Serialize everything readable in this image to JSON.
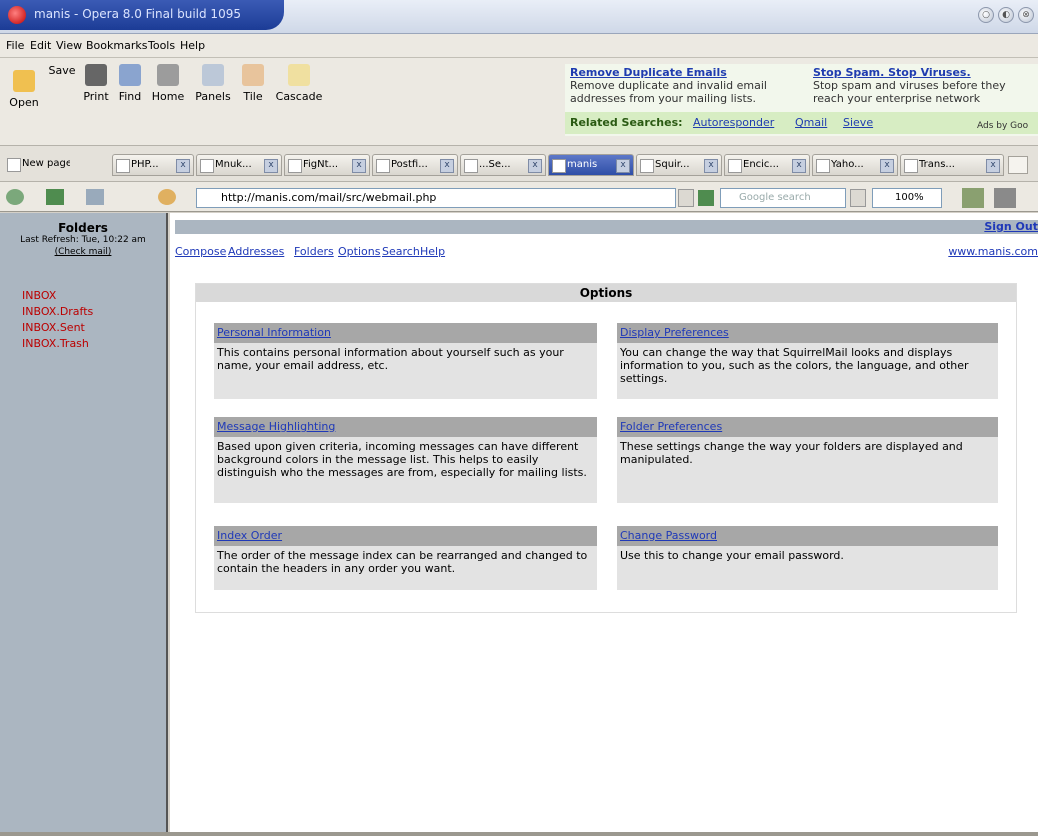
{
  "window": {
    "title": "manis - Opera 8.0 Final build 1095",
    "controls": [
      "○",
      "◐",
      "⊗"
    ]
  },
  "menu": [
    "File",
    "Edit",
    "View",
    "Bookmarks",
    "Tools",
    "Help"
  ],
  "toolbar": {
    "open": "Open",
    "save": "Save",
    "print": "Print",
    "find": "Find",
    "home": "Home",
    "panels": "Panels",
    "tile": "Tile",
    "cascade": "Cascade"
  },
  "ads": {
    "ad1_title": "Remove Duplicate Emails",
    "ad1_text": "Remove duplicate and invalid email addresses from your mailing lists.",
    "ad2_title": "Stop Spam. Stop Viruses.",
    "ad2_text": "Stop spam and viruses before they reach your enterprise network",
    "related_prefix": "Related Searches:",
    "related_1": "Autoresponder",
    "related_2": "Qmail",
    "related_3": "Sieve",
    "ads_by": "Ads by Goo"
  },
  "tabs": [
    "New page",
    "PHP...",
    "Mnuk...",
    "FigNt...",
    "Postfi...",
    "...Se...",
    "manis",
    "Squir...",
    "Encic...",
    "Yaho...",
    "Trans..."
  ],
  "address": {
    "url": "http://manis.com/mail/src/webmail.php",
    "search_placeholder": "Google search",
    "zoom": "100%"
  },
  "sidebar": {
    "title": "Folders",
    "last_refresh": "Last Refresh: Tue, 10:22 am",
    "check_mail": "(Check mail)",
    "folders": [
      "INBOX",
      "INBOX.Drafts",
      "INBOX.Sent",
      "INBOX.Trash"
    ]
  },
  "main": {
    "sign_out": "Sign Out",
    "nav": [
      "Compose",
      "Addresses",
      "Folders",
      "Options",
      "Search",
      "Help"
    ],
    "site": "www.manis.com",
    "options_title": "Options",
    "options": [
      {
        "title": "Personal Information",
        "desc": "This contains personal information about yourself such as your name, your email address, etc."
      },
      {
        "title": "Display Preferences",
        "desc": "You can change the way that SquirrelMail looks and displays information to you, such as the colors, the language, and other settings."
      },
      {
        "title": "Message Highlighting",
        "desc": "Based upon given criteria, incoming messages can have different background colors in the message list. This helps to easily distinguish who the messages are from, especially for mailing lists."
      },
      {
        "title": "Folder Preferences",
        "desc": "These settings change the way your folders are displayed and manipulated."
      },
      {
        "title": "Index Order",
        "desc": "The order of the message index can be rearranged and changed to contain the headers in any order you want."
      },
      {
        "title": "Change Password",
        "desc": "Use this to change your email password."
      }
    ]
  }
}
